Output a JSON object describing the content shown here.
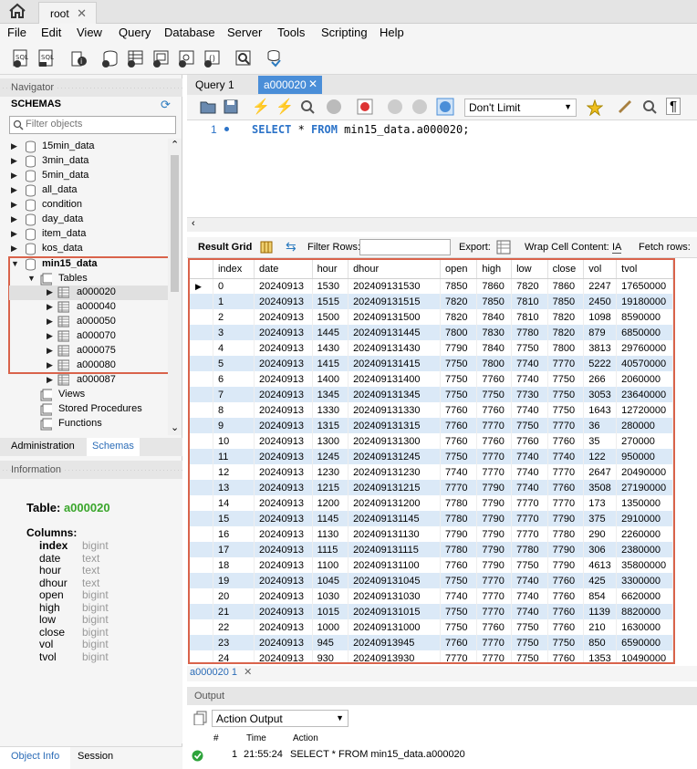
{
  "connection_tab": {
    "label": "root"
  },
  "menu": [
    "File",
    "Edit",
    "View",
    "Query",
    "Database",
    "Server",
    "Tools",
    "Scripting",
    "Help"
  ],
  "navigator": {
    "title": "Navigator",
    "schemas_label": "SCHEMAS",
    "filter_placeholder": "Filter objects",
    "schemas": [
      "15min_data",
      "3min_data",
      "5min_data",
      "all_data",
      "condition",
      "day_data",
      "item_data",
      "kos_data"
    ],
    "expanded_schema": "min15_data",
    "tables_label": "Tables",
    "tables": [
      "a000020",
      "a000040",
      "a000050",
      "a000070",
      "a000075",
      "a000080",
      "a000087"
    ],
    "other_nodes": [
      "Views",
      "Stored Procedures",
      "Functions"
    ],
    "cut_off": "min5_data"
  },
  "admin_tabs": {
    "administration": "Administration",
    "schemas": "Schemas"
  },
  "information": {
    "title": "Information",
    "table_prefix": "Table:",
    "table_name": "a000020",
    "columns_label": "Columns:",
    "columns": [
      {
        "name": "index",
        "type": "bigint"
      },
      {
        "name": "date",
        "type": "text"
      },
      {
        "name": "hour",
        "type": "text"
      },
      {
        "name": "dhour",
        "type": "text"
      },
      {
        "name": "open",
        "type": "bigint"
      },
      {
        "name": "high",
        "type": "bigint"
      },
      {
        "name": "low",
        "type": "bigint"
      },
      {
        "name": "close",
        "type": "bigint"
      },
      {
        "name": "vol",
        "type": "bigint"
      },
      {
        "name": "tvol",
        "type": "bigint"
      }
    ]
  },
  "bottom_tabs": {
    "object_info": "Object Info",
    "session": "Session"
  },
  "editor": {
    "tabs": [
      "Query 1",
      "a000020"
    ],
    "limit": "Don't Limit",
    "line_number": "1",
    "sql": "SELECT * FROM min15_data.a000020;"
  },
  "result_toolbar": {
    "result_grid": "Result Grid",
    "filter_rows": "Filter Rows:",
    "export": "Export:",
    "wrap": "Wrap Cell Content:",
    "fetch": "Fetch rows:"
  },
  "grid": {
    "columns": [
      "index",
      "date",
      "hour",
      "dhour",
      "open",
      "high",
      "low",
      "close",
      "vol",
      "tvol"
    ],
    "rows": [
      [
        "0",
        "20240913",
        "1530",
        "202409131530",
        "7850",
        "7860",
        "7820",
        "7860",
        "2247",
        "17650000"
      ],
      [
        "1",
        "20240913",
        "1515",
        "202409131515",
        "7820",
        "7850",
        "7810",
        "7850",
        "2450",
        "19180000"
      ],
      [
        "2",
        "20240913",
        "1500",
        "202409131500",
        "7820",
        "7840",
        "7810",
        "7820",
        "1098",
        "8590000"
      ],
      [
        "3",
        "20240913",
        "1445",
        "202409131445",
        "7800",
        "7830",
        "7780",
        "7820",
        "879",
        "6850000"
      ],
      [
        "4",
        "20240913",
        "1430",
        "202409131430",
        "7790",
        "7840",
        "7750",
        "7800",
        "3813",
        "29760000"
      ],
      [
        "5",
        "20240913",
        "1415",
        "202409131415",
        "7750",
        "7800",
        "7740",
        "7770",
        "5222",
        "40570000"
      ],
      [
        "6",
        "20240913",
        "1400",
        "202409131400",
        "7750",
        "7760",
        "7740",
        "7750",
        "266",
        "2060000"
      ],
      [
        "7",
        "20240913",
        "1345",
        "202409131345",
        "7750",
        "7750",
        "7730",
        "7750",
        "3053",
        "23640000"
      ],
      [
        "8",
        "20240913",
        "1330",
        "202409131330",
        "7760",
        "7760",
        "7740",
        "7750",
        "1643",
        "12720000"
      ],
      [
        "9",
        "20240913",
        "1315",
        "202409131315",
        "7760",
        "7770",
        "7750",
        "7770",
        "36",
        "280000"
      ],
      [
        "10",
        "20240913",
        "1300",
        "202409131300",
        "7760",
        "7760",
        "7760",
        "7760",
        "35",
        "270000"
      ],
      [
        "11",
        "20240913",
        "1245",
        "202409131245",
        "7750",
        "7770",
        "7740",
        "7740",
        "122",
        "950000"
      ],
      [
        "12",
        "20240913",
        "1230",
        "202409131230",
        "7740",
        "7770",
        "7740",
        "7770",
        "2647",
        "20490000"
      ],
      [
        "13",
        "20240913",
        "1215",
        "202409131215",
        "7770",
        "7790",
        "7740",
        "7760",
        "3508",
        "27190000"
      ],
      [
        "14",
        "20240913",
        "1200",
        "202409131200",
        "7780",
        "7790",
        "7770",
        "7770",
        "173",
        "1350000"
      ],
      [
        "15",
        "20240913",
        "1145",
        "202409131145",
        "7780",
        "7790",
        "7770",
        "7790",
        "375",
        "2910000"
      ],
      [
        "16",
        "20240913",
        "1130",
        "202409131130",
        "7790",
        "7790",
        "7770",
        "7780",
        "290",
        "2260000"
      ],
      [
        "17",
        "20240913",
        "1115",
        "202409131115",
        "7780",
        "7790",
        "7780",
        "7790",
        "306",
        "2380000"
      ],
      [
        "18",
        "20240913",
        "1100",
        "202409131100",
        "7760",
        "7790",
        "7750",
        "7790",
        "4613",
        "35800000"
      ],
      [
        "19",
        "20240913",
        "1045",
        "202409131045",
        "7750",
        "7770",
        "7740",
        "7760",
        "425",
        "3300000"
      ],
      [
        "20",
        "20240913",
        "1030",
        "202409131030",
        "7740",
        "7770",
        "7740",
        "7760",
        "854",
        "6620000"
      ],
      [
        "21",
        "20240913",
        "1015",
        "202409131015",
        "7750",
        "7770",
        "7740",
        "7760",
        "1139",
        "8820000"
      ],
      [
        "22",
        "20240913",
        "1000",
        "202409131000",
        "7750",
        "7760",
        "7750",
        "7760",
        "210",
        "1630000"
      ],
      [
        "23",
        "20240913",
        "945",
        "20240913945",
        "7760",
        "7770",
        "7750",
        "7750",
        "850",
        "6590000"
      ],
      [
        "24",
        "20240913",
        "930",
        "20240913930",
        "7770",
        "7770",
        "7750",
        "7760",
        "1353",
        "10490000"
      ]
    ]
  },
  "result_tab": "a000020 1",
  "output": {
    "title": "Output",
    "selector": "Action Output",
    "headers": {
      "num": "#",
      "time": "Time",
      "action": "Action"
    },
    "row": {
      "num": "1",
      "time": "21:55:24",
      "action": "SELECT * FROM min15_data.a000020"
    }
  },
  "colors": {
    "accent": "#4a8ed8",
    "highlight_border": "#d9634b",
    "alt_row": "#dbe9f7",
    "sql_keyword": "#2c73c8"
  }
}
